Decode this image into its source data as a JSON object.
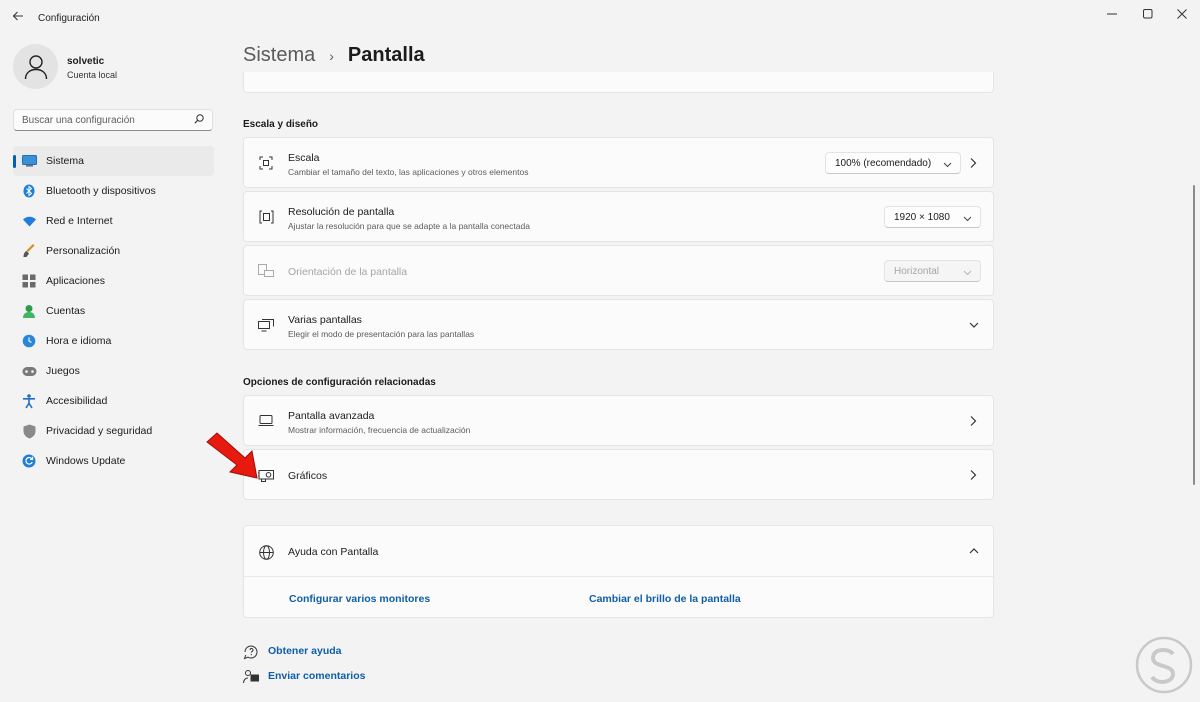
{
  "window": {
    "title": "Configuración",
    "controls": [
      "minimize",
      "maximize",
      "close"
    ]
  },
  "user": {
    "name": "solvetic",
    "account_type": "Cuenta local"
  },
  "search": {
    "placeholder": "Buscar una configuración"
  },
  "sidebar": {
    "items": [
      {
        "label": "Sistema",
        "icon": "monitor-icon",
        "active": true
      },
      {
        "label": "Bluetooth y dispositivos",
        "icon": "bluetooth-icon"
      },
      {
        "label": "Red e Internet",
        "icon": "wifi-icon"
      },
      {
        "label": "Personalización",
        "icon": "brush-icon"
      },
      {
        "label": "Aplicaciones",
        "icon": "apps-icon"
      },
      {
        "label": "Cuentas",
        "icon": "person-icon"
      },
      {
        "label": "Hora e idioma",
        "icon": "globe-clock-icon"
      },
      {
        "label": "Juegos",
        "icon": "gamepad-icon"
      },
      {
        "label": "Accesibilidad",
        "icon": "accessibility-icon"
      },
      {
        "label": "Privacidad y seguridad",
        "icon": "shield-icon"
      },
      {
        "label": "Windows Update",
        "icon": "update-icon"
      }
    ]
  },
  "breadcrumb": {
    "parent": "Sistema",
    "separator": "›",
    "current": "Pantalla"
  },
  "scale_section": {
    "heading": "Escala y diseño",
    "rows": [
      {
        "title": "Escala",
        "subtitle": "Cambiar el tamaño del texto, las aplicaciones y otros elementos",
        "value": "100% (recomendado)"
      },
      {
        "title": "Resolución de pantalla",
        "subtitle": "Ajustar la resolución para que se adapte a la pantalla conectada",
        "value": "1920 × 1080"
      },
      {
        "title": "Orientación de la pantalla",
        "value": "Horizontal",
        "disabled": true
      },
      {
        "title": "Varias pantallas",
        "subtitle": "Elegir el modo de presentación para las pantallas"
      }
    ]
  },
  "related_section": {
    "heading": "Opciones de configuración relacionadas",
    "rows": [
      {
        "title": "Pantalla avanzada",
        "subtitle": "Mostrar información, frecuencia de actualización"
      },
      {
        "title": "Gráficos"
      }
    ]
  },
  "help": {
    "title": "Ayuda con Pantalla",
    "links": [
      "Configurar varios monitores",
      "Cambiar el brillo de la pantalla"
    ]
  },
  "footer": {
    "get_help": "Obtener ayuda",
    "feedback": "Enviar comentarios"
  },
  "colors": {
    "accent": "#005fb8",
    "link": "#0f5ea8",
    "background": "#f3f3f3",
    "card": "#fbfbfb",
    "annotation_arrow": "#e8190f"
  }
}
